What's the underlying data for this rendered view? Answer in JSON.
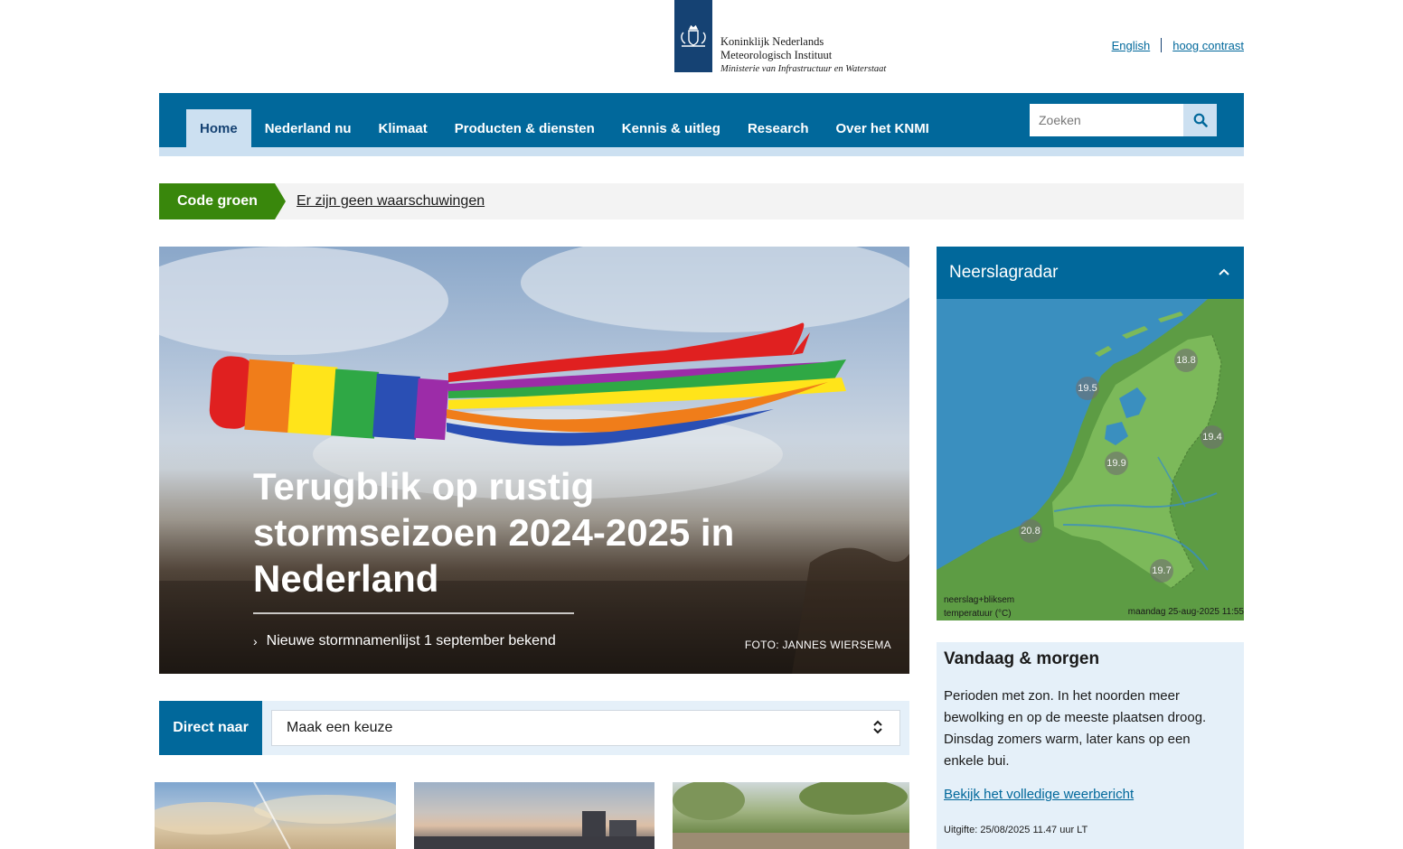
{
  "header": {
    "logo_line1": "Koninklijk Nederlands",
    "logo_line2": "Meteorologisch Instituut",
    "logo_line3": "Ministerie van Infrastructuur en Waterstaat",
    "link_english": "English",
    "link_contrast": "hoog contrast"
  },
  "nav": {
    "items": [
      {
        "label": "Home",
        "active": true
      },
      {
        "label": "Nederland nu"
      },
      {
        "label": "Klimaat"
      },
      {
        "label": "Producten & diensten"
      },
      {
        "label": "Kennis & uitleg"
      },
      {
        "label": "Research"
      },
      {
        "label": "Over het KNMI"
      }
    ],
    "search_placeholder": "Zoeken"
  },
  "warning": {
    "code": "Code groen",
    "message": "Er zijn geen waarschuwingen"
  },
  "hero": {
    "title": "Terugblik op rustig stormseizoen 2024-2025 in Nederland",
    "link": "Nieuwe stormnamenlijst 1 september bekend",
    "credit": "FOTO: JANNES WIERSEMA"
  },
  "direct": {
    "label": "Direct naar",
    "selected": "Maak een keuze"
  },
  "radar": {
    "title": "Neerslagradar",
    "temps": [
      "18.8",
      "19.5",
      "19.4",
      "19.9",
      "20.8",
      "19.7"
    ],
    "legend_line1": "neerslag+bliksem",
    "legend_line2": "temperatuur (°C)",
    "timestamp": "maandag 25-aug-2025 11:55"
  },
  "forecast": {
    "title": "Vandaag & morgen",
    "text": "Perioden met zon. In het noorden meer bewolking en op de meeste plaatsen droog. Dinsdag zomers warm, later kans op een enkele bui.",
    "link": "Bekijk het volledige weerbericht",
    "issued": "Uitgifte: 25/08/2025 11.47 uur LT"
  },
  "colors": {
    "brand_blue": "#01689b",
    "rijks_blue": "#154273",
    "light_blue": "#cce0f1",
    "code_green": "#39870c"
  }
}
